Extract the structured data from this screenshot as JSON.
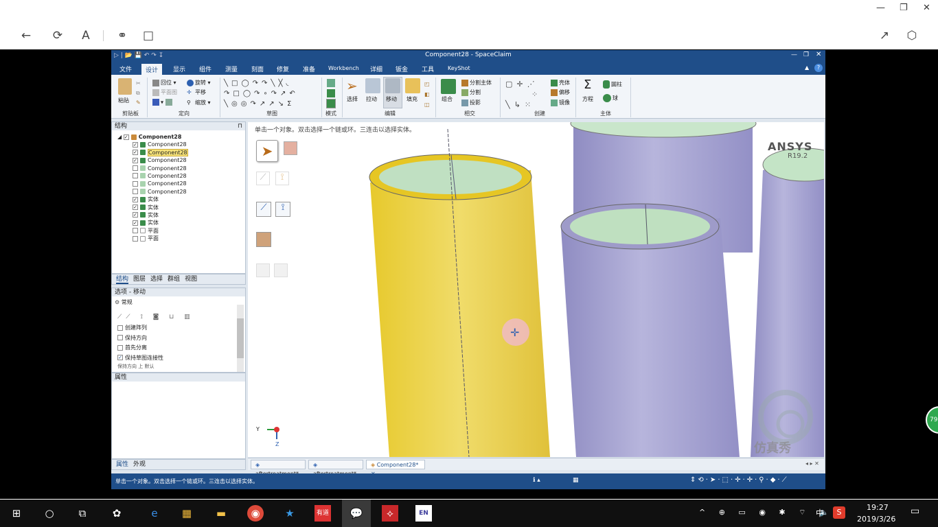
{
  "app": {
    "title": "Component28 - SpaceClaim",
    "menu": [
      "文件",
      "设计",
      "显示",
      "组件",
      "测量",
      "刻面",
      "修复",
      "准备",
      "Workbench",
      "详细",
      "钣金",
      "工具",
      "KeyShot"
    ],
    "active_menu": "设计"
  },
  "ribbon": {
    "clipboard": {
      "paste": "粘贴",
      "group": "剪贴板"
    },
    "orient": {
      "home": "回位",
      "rotate": "旋转",
      "plan": "平面图",
      "pan": "平移",
      "zoom": "缩放",
      "group": "定向"
    },
    "sketch": {
      "group": "草图"
    },
    "mode": {
      "group": "模式"
    },
    "edit": {
      "select": "选择",
      "pull": "拉动",
      "move": "移动",
      "fill": "填充",
      "group": "编辑"
    },
    "intersect": {
      "combine": "组合",
      "split_body": "分割主体",
      "split": "分割",
      "project": "投影",
      "group": "相交"
    },
    "create": {
      "shell": "壳体",
      "offset": "偏移",
      "mirror": "镜像",
      "group": "创建"
    },
    "body": {
      "equation": "方程",
      "cylinder": "圆柱",
      "sphere": "球",
      "group": "主体"
    }
  },
  "structure": {
    "title": "结构",
    "root": "Component28",
    "items": [
      {
        "label": "Component28",
        "checked": true,
        "highlight": false
      },
      {
        "label": "Component28",
        "checked": true,
        "highlight": true
      },
      {
        "label": "Component28",
        "checked": true,
        "highlight": false
      },
      {
        "label": "Component28",
        "checked": false,
        "highlight": false
      },
      {
        "label": "Component28",
        "checked": false,
        "highlight": false
      },
      {
        "label": "Component28",
        "checked": false,
        "highlight": false
      },
      {
        "label": "Component28",
        "checked": false,
        "highlight": false
      },
      {
        "label": "实体",
        "checked": true,
        "highlight": false
      },
      {
        "label": "实体",
        "checked": true,
        "highlight": false
      },
      {
        "label": "实体",
        "checked": true,
        "highlight": false
      },
      {
        "label": "实体",
        "checked": true,
        "highlight": false
      },
      {
        "label": "平面",
        "checked": false,
        "highlight": false
      },
      {
        "label": "平面",
        "checked": false,
        "highlight": false
      }
    ],
    "tabs": [
      "结构",
      "图层",
      "选择",
      "群组",
      "视图"
    ]
  },
  "options": {
    "title": "选项 - 移动",
    "section": "常规",
    "checks": [
      {
        "label": "创建阵列",
        "checked": false
      },
      {
        "label": "保持方向",
        "checked": false
      },
      {
        "label": "首先分离",
        "checked": false
      },
      {
        "label": "保持草图连接性",
        "checked": true
      }
    ],
    "cutoff": "保持方向  上  默认"
  },
  "properties": {
    "title": "属性",
    "tabs": [
      "属性",
      "外观"
    ]
  },
  "viewport": {
    "hint": "单击一个对象。双击选择一个链或环。三连击以选择实体。",
    "brand": "ANSYS",
    "version": "R19.2",
    "watermark": "仿真秀",
    "axis_y": "Y",
    "axis_z": "Z"
  },
  "doc_tabs": [
    "aftertreatment*",
    "aftertreatment*",
    "Component28*"
  ],
  "status": {
    "text": "单击一个对象。双击选择一个链或环。三连击以选择实体。"
  },
  "taskbar": {
    "time": "19:27",
    "date": "2019/3/26",
    "ime": "中",
    "badge": "79"
  },
  "colors": {
    "title_blue": "#1f4e89",
    "yellow_body": "#e8cf3a",
    "purple_body": "#9d9ac8",
    "inner_green": "#bfe0c0"
  }
}
